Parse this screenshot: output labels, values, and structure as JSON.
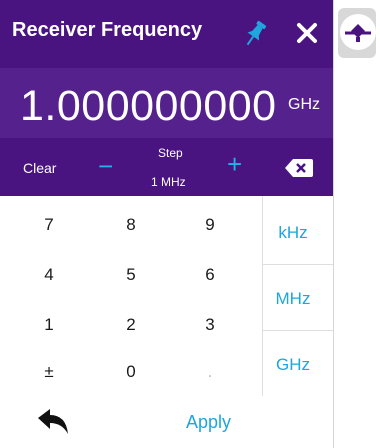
{
  "dialog": {
    "title": "Receiver Frequency",
    "value": "1.000000000",
    "unit": "GHz",
    "clear_label": "Clear",
    "minus_label": "−",
    "plus_label": "+",
    "step_label": "Step",
    "step_value": "1 MHz"
  },
  "keypad": {
    "keys": [
      "7",
      "8",
      "9",
      "4",
      "5",
      "6",
      "1",
      "2",
      "3",
      "±",
      "0",
      "."
    ],
    "units": [
      "kHz",
      "MHz",
      "GHz"
    ],
    "apply_label": "Apply"
  },
  "colors": {
    "title_bg": "#4a1480",
    "value_bg": "#55228d",
    "accent": "#1ea6dd"
  },
  "icons": {
    "pin": "pin-icon",
    "close": "close-icon",
    "backspace": "backspace-icon",
    "back": "back-arrow-icon",
    "side": "marker-icon"
  }
}
